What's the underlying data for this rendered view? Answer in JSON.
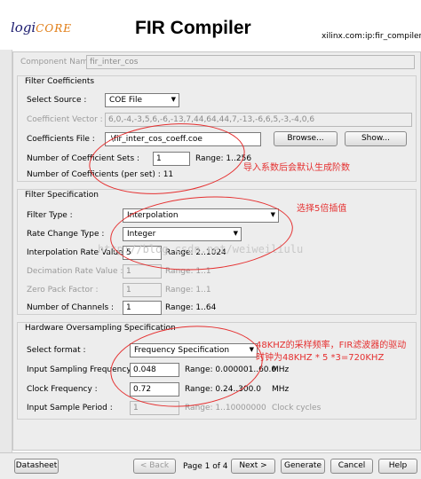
{
  "header": {
    "logo_main": "logi",
    "logo_core": "CORE",
    "title": "FIR Compiler",
    "vlnv": "xilinx.com:ip:fir_compiler:5."
  },
  "component": {
    "label": "Component Name",
    "value": "fir_inter_cos"
  },
  "filter_coefficients": {
    "title": "Filter Coefficients",
    "select_source_label": "Select Source :",
    "select_source_value": "COE File",
    "coeff_vector_label": "Coefficient Vector :",
    "coeff_vector_value": "6,0,-4,-3,5,6,-6,-13,7,44,64,44,7,-13,-6,6,5,-3,-4,0,6",
    "coeff_file_label": "Coefficients File :",
    "coeff_file_value": ".\\fir_inter_cos_coeff.coe",
    "browse_label": "Browse...",
    "show_label": "Show...",
    "num_sets_label": "Number of Coefficient Sets :",
    "num_sets_value": "1",
    "num_sets_range": "Range: 1..256",
    "num_per_set_label": "Number of Coefficients (per set) : 11"
  },
  "filter_spec": {
    "title": "Filter Specification",
    "filter_type_label": "Filter Type :",
    "filter_type_value": "Interpolation",
    "rate_change_label": "Rate Change Type :",
    "rate_change_value": "Integer",
    "interp_rate_label": "Interpolation Rate Value :",
    "interp_rate_value": "5",
    "interp_rate_range": "Range: 2..1024",
    "decim_rate_label": "Decimation Rate Value :",
    "decim_rate_value": "1",
    "decim_rate_range": "Range: 1..1",
    "zero_pack_label": "Zero Pack Factor :",
    "zero_pack_value": "1",
    "zero_pack_range": "Range: 1..1",
    "num_channels_label": "Number of Channels :",
    "num_channels_value": "1",
    "num_channels_range": "Range: 1..64"
  },
  "hw_spec": {
    "title": "Hardware Oversampling Specification",
    "select_format_label": "Select format :",
    "select_format_value": "Frequency Specification",
    "input_freq_label": "Input Sampling Frequency :",
    "input_freq_value": "0.048",
    "input_freq_range": "Range: 0.000001..60.0",
    "input_freq_unit": "MHz",
    "clock_freq_label": "Clock Frequency :",
    "clock_freq_value": "0.72",
    "clock_freq_range": "Range: 0.24..300.0",
    "clock_freq_unit": "MHz",
    "sample_period_label": "Input Sample Period :",
    "sample_period_value": "1",
    "sample_period_range": "Range: 1..10000000",
    "sample_period_unit": "Clock cycles"
  },
  "annotations": {
    "note1": "导入系数后会默认生成阶数",
    "note2": "选择5倍插值",
    "note3_line1": "48KHZ的采样频率，FIR滤波器的驱动",
    "note3_line2": "时钟为48KHZ * 5 *3=720KHZ",
    "watermark": "http://blog.csdn.net/weiweiliulu"
  },
  "footer": {
    "datasheet": "Datasheet",
    "back": "< Back",
    "page": "Page 1 of 4",
    "next": "Next >",
    "generate": "Generate",
    "cancel": "Cancel",
    "help": "Help"
  },
  "colors": {
    "annotation": "#e53030",
    "logo": "#1a1a6e",
    "logo_accent": "#e07a10"
  }
}
